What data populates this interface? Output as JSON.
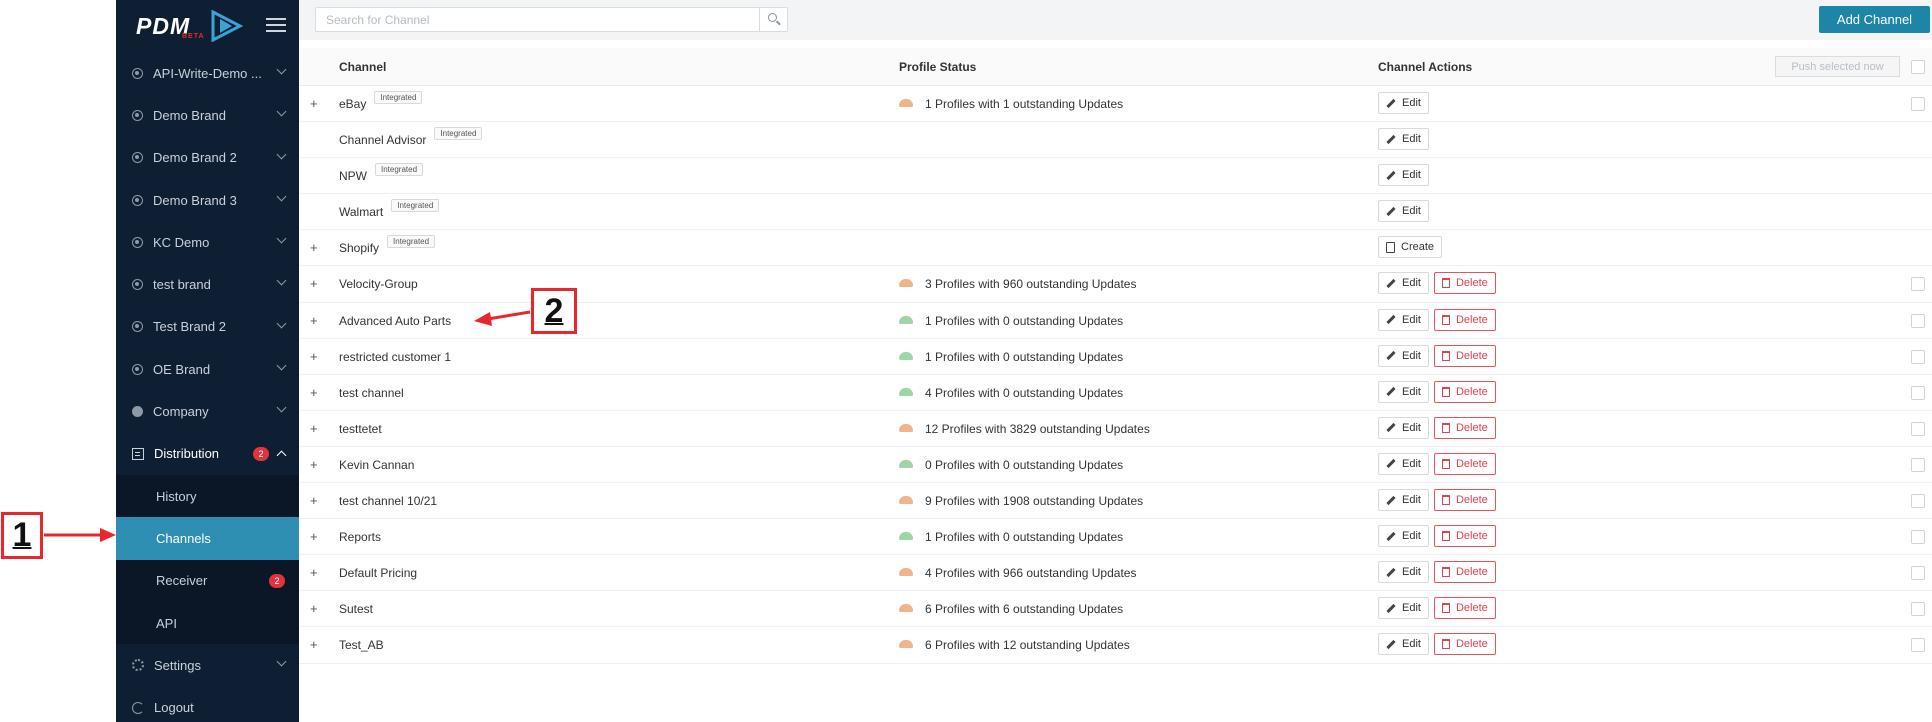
{
  "callouts": [
    "1",
    "2"
  ],
  "sidebar": {
    "logo": "PDM",
    "logo_badge": "BETA",
    "items": [
      {
        "label": "API-Write-Demo ..."
      },
      {
        "label": "Demo Brand"
      },
      {
        "label": "Demo Brand 2"
      },
      {
        "label": "Demo Brand 3"
      },
      {
        "label": "KC Demo"
      },
      {
        "label": "test brand"
      },
      {
        "label": "Test Brand 2"
      },
      {
        "label": "OE Brand"
      },
      {
        "label": "Company"
      }
    ],
    "distribution": {
      "label": "Distribution",
      "badge": "2"
    },
    "sub_items": [
      {
        "label": "History",
        "badge": ""
      },
      {
        "label": "Channels",
        "badge": ""
      },
      {
        "label": "Receiver",
        "badge": "2"
      },
      {
        "label": "API",
        "badge": ""
      }
    ],
    "settings": "Settings",
    "logout": "Logout"
  },
  "search": {
    "placeholder": "Search for Channel",
    "value": ""
  },
  "toolbar": {
    "add_channel": "Add Channel",
    "push_selected": "Push selected now"
  },
  "table": {
    "headers": {
      "channel": "Channel",
      "status": "Profile Status",
      "actions": "Channel Actions"
    },
    "edit_label": "Edit",
    "delete_label": "Delete",
    "create_label": "Create",
    "rows": [
      {
        "name": "eBay",
        "tag": "Integrated",
        "status": "1 Profiles with 1 outstanding Updates",
        "status_color": "orange",
        "plus": true,
        "action": "edit",
        "checkbox": true
      },
      {
        "name": "Channel Advisor",
        "tag": "Integrated",
        "status": "",
        "status_color": "",
        "plus": false,
        "action": "edit",
        "checkbox": false
      },
      {
        "name": "NPW",
        "tag": "Integrated",
        "status": "",
        "status_color": "",
        "plus": false,
        "action": "edit",
        "checkbox": false
      },
      {
        "name": "Walmart",
        "tag": "Integrated",
        "status": "",
        "status_color": "",
        "plus": false,
        "action": "edit",
        "checkbox": false
      },
      {
        "name": "Shopify",
        "tag": "Integrated",
        "status": "",
        "status_color": "",
        "plus": true,
        "action": "create",
        "checkbox": false
      },
      {
        "name": "Velocity-Group",
        "tag": "",
        "status": "3 Profiles with 960 outstanding Updates",
        "status_color": "orange",
        "plus": true,
        "action": "edit-delete",
        "checkbox": true
      },
      {
        "name": "Advanced Auto Parts",
        "tag": "",
        "status": "1 Profiles with 0 outstanding Updates",
        "status_color": "green",
        "plus": true,
        "action": "edit-delete",
        "checkbox": true
      },
      {
        "name": "restricted customer 1",
        "tag": "",
        "status": "1 Profiles with 0 outstanding Updates",
        "status_color": "green",
        "plus": true,
        "action": "edit-delete",
        "checkbox": true
      },
      {
        "name": "test channel",
        "tag": "",
        "status": "4 Profiles with 0 outstanding Updates",
        "status_color": "green",
        "plus": true,
        "action": "edit-delete",
        "checkbox": true
      },
      {
        "name": "testtetet",
        "tag": "",
        "status": "12 Profiles with 3829 outstanding Updates",
        "status_color": "orange",
        "plus": true,
        "action": "edit-delete",
        "checkbox": true
      },
      {
        "name": "Kevin Cannan",
        "tag": "",
        "status": "0 Profiles with 0 outstanding Updates",
        "status_color": "green",
        "plus": true,
        "action": "edit-delete",
        "checkbox": true
      },
      {
        "name": "test channel 10/21",
        "tag": "",
        "status": "9 Profiles with 1908 outstanding Updates",
        "status_color": "orange",
        "plus": true,
        "action": "edit-delete",
        "checkbox": true
      },
      {
        "name": "Reports",
        "tag": "",
        "status": "1 Profiles with 0 outstanding Updates",
        "status_color": "green",
        "plus": true,
        "action": "edit-delete",
        "checkbox": true
      },
      {
        "name": "Default Pricing",
        "tag": "",
        "status": "4 Profiles with 966 outstanding Updates",
        "status_color": "orange",
        "plus": true,
        "action": "edit-delete",
        "checkbox": true
      },
      {
        "name": "Sutest",
        "tag": "",
        "status": "6 Profiles with 6 outstanding Updates",
        "status_color": "orange",
        "plus": true,
        "action": "edit-delete",
        "checkbox": true
      },
      {
        "name": "Test_AB",
        "tag": "",
        "status": "6 Profiles with 12 outstanding Updates",
        "status_color": "orange",
        "plus": true,
        "action": "edit-delete",
        "checkbox": true
      }
    ]
  },
  "colors": {
    "sidebar_bg": "#0f1f33",
    "active": "#2f8fb3",
    "accent": "#1d86a8",
    "danger": "#e0434b",
    "callout": "#e8262c"
  }
}
